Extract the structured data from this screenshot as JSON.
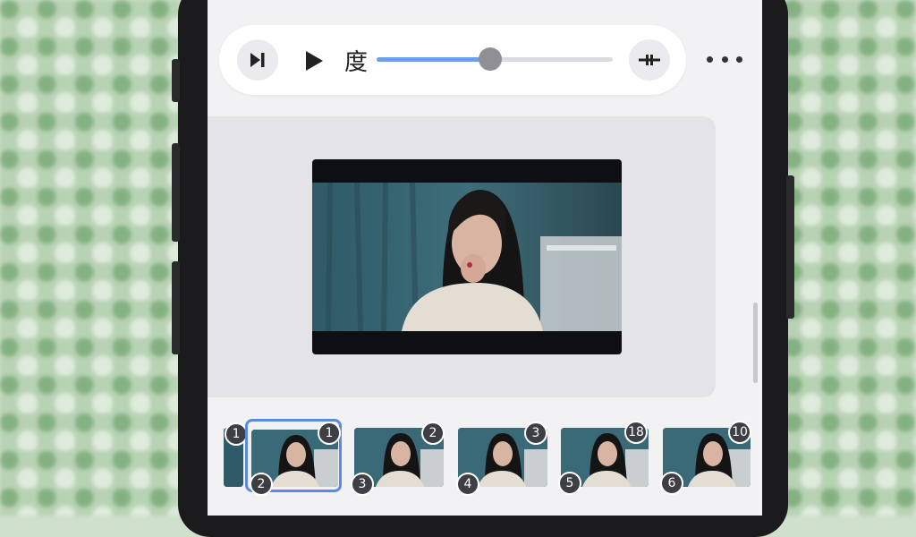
{
  "toolbar": {
    "speed_label": "度",
    "progress": 0.48
  },
  "thumbnails": [
    {
      "top_badge": "1",
      "bottom_badge": ""
    },
    {
      "top_badge": "1",
      "bottom_badge": "2"
    },
    {
      "top_badge": "2",
      "bottom_badge": "3"
    },
    {
      "top_badge": "3",
      "bottom_badge": "4"
    },
    {
      "top_badge": "18",
      "bottom_badge": "5"
    },
    {
      "top_badge": "10",
      "bottom_badge": "6"
    }
  ],
  "colors": {
    "accent": "#6d9ee8",
    "selection": "#5a8be0"
  },
  "icons": [
    "skip-next-icon",
    "play-icon",
    "split-icon",
    "more-icon"
  ]
}
